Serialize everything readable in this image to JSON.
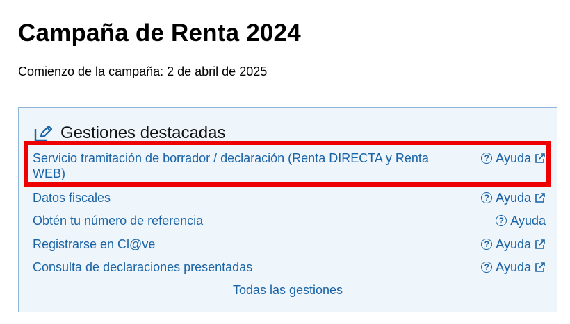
{
  "page": {
    "title": "Campaña de Renta 2024",
    "subtitle": "Comienzo de la campaña: 2 de abril de 2025"
  },
  "panel": {
    "title": "Gestiones destacadas",
    "icon": "edit-icon",
    "items": [
      {
        "label": "Servicio tramitación de borrador / declaración (Renta DIRECTA y Renta WEB)",
        "help": "Ayuda",
        "external": true
      },
      {
        "label": "Datos fiscales",
        "help": "Ayuda",
        "external": true
      },
      {
        "label": "Obtén tu número de referencia",
        "help": "Ayuda",
        "external": false
      },
      {
        "label": "Registrarse en Cl@ve",
        "help": "Ayuda",
        "external": true
      },
      {
        "label": "Consulta de declaraciones presentadas",
        "help": "Ayuda",
        "external": true
      }
    ],
    "all_link": "Todas las gestiones"
  },
  "colors": {
    "link": "#1a63a6",
    "panel_bg": "#eef5fb",
    "panel_border": "#8fb4d6",
    "highlight": "#ee0000"
  }
}
